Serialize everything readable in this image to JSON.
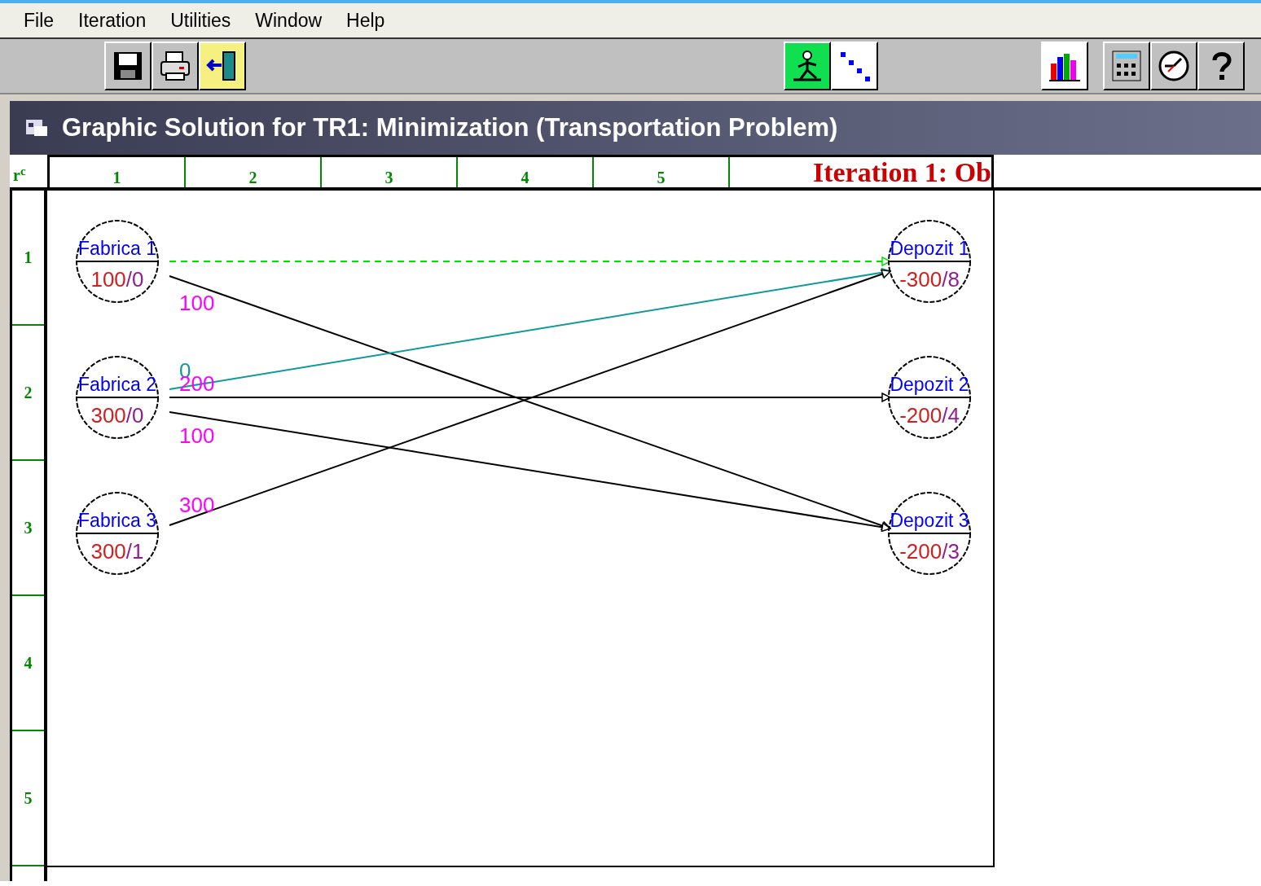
{
  "menu": [
    "File",
    "Iteration",
    "Utilities",
    "Window",
    "Help"
  ],
  "window": {
    "title": "Graphic Solution for TR1: Minimization (Transportation Problem)"
  },
  "grid": {
    "corner": "r$^{c}$",
    "columns": [
      "1",
      "2",
      "3",
      "4",
      "5"
    ],
    "rows": [
      "1",
      "2",
      "3",
      "4",
      "5"
    ],
    "heading": "Iteration 1: Ob"
  },
  "sources": [
    {
      "name": "Fabrica 1",
      "amount": "100",
      "potential": "/0",
      "arcs": [
        {
          "kind": "entering"
        },
        {
          "kind": "none"
        },
        {
          "kind": "basic",
          "flow": "100"
        }
      ]
    },
    {
      "name": "Fabrica 2",
      "amount": "300",
      "potential": "/0",
      "arcs": [
        {
          "kind": "degenerate",
          "flow": "0"
        },
        {
          "kind": "basic",
          "flow": "200"
        },
        {
          "kind": "basic",
          "flow": "100"
        }
      ]
    },
    {
      "name": "Fabrica 3",
      "amount": "300",
      "potential": "/1",
      "arcs": [
        {
          "kind": "basic",
          "flow": "300"
        },
        {
          "kind": "none"
        },
        {
          "kind": "none"
        }
      ]
    }
  ],
  "depots": [
    {
      "name": "Depozit 1",
      "amount": "-300",
      "potential": "/8"
    },
    {
      "name": "Depozit 2",
      "amount": "-200",
      "potential": "/4"
    },
    {
      "name": "Depozit 3",
      "amount": "-200",
      "potential": "/3"
    }
  ]
}
